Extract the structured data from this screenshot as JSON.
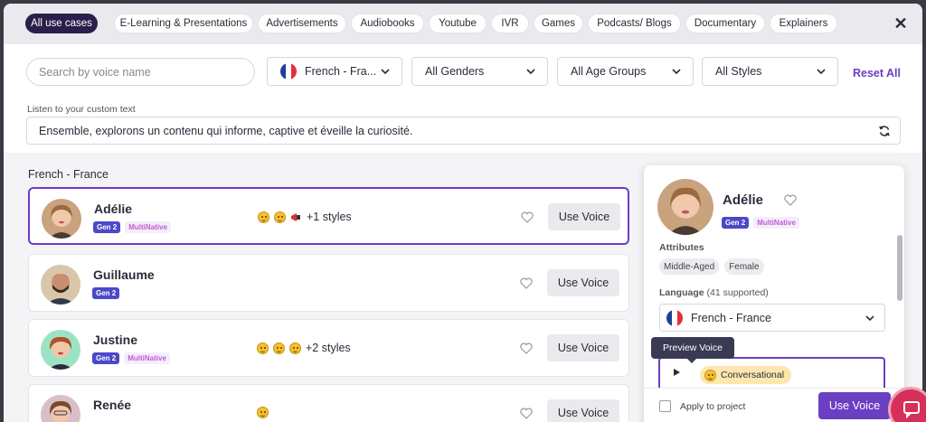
{
  "tabs": [
    {
      "label": "All use cases",
      "active": true
    },
    {
      "label": "E-Learning & Presentations",
      "active": false
    },
    {
      "label": "Advertisements",
      "active": false
    },
    {
      "label": "Audiobooks",
      "active": false
    },
    {
      "label": "Youtube",
      "active": false
    },
    {
      "label": "IVR",
      "active": false
    },
    {
      "label": "Games",
      "active": false
    },
    {
      "label": "Podcasts/ Blogs",
      "active": false
    },
    {
      "label": "Documentary",
      "active": false
    },
    {
      "label": "Explainers",
      "active": false
    }
  ],
  "close_label": "✕",
  "filters": {
    "search_placeholder": "Search by voice name",
    "language": "French - Fra...",
    "gender": "All Genders",
    "age": "All Age Groups",
    "style": "All Styles",
    "reset": "Reset All"
  },
  "custom_text": {
    "label": "Listen to your custom text",
    "value": "Ensemble, explorons un contenu qui informe, captive et éveille la curiosité."
  },
  "language_heading": "French - France",
  "voices": [
    {
      "name": "Adélie",
      "gen": "Gen 2",
      "multi": "MultiNative",
      "styles_more": "+1 styles",
      "use_label": "Use Voice"
    },
    {
      "name": "Guillaume",
      "gen": "Gen 2",
      "multi": "",
      "styles_more": "",
      "use_label": "Use Voice"
    },
    {
      "name": "Justine",
      "gen": "Gen 2",
      "multi": "MultiNative",
      "styles_more": "+2 styles",
      "use_label": "Use Voice"
    },
    {
      "name": "Renée",
      "gen": "",
      "multi": "",
      "styles_more": "",
      "use_label": "Use Voice"
    }
  ],
  "panel": {
    "name": "Adélie",
    "gen": "Gen 2",
    "multi": "MultiNative",
    "attributes_label": "Attributes",
    "attributes": [
      "Middle-Aged",
      "Female"
    ],
    "language_label": "Language",
    "language_count": "(41 supported)",
    "language_value": "French - France",
    "tooltip": "Preview Voice",
    "style_label": "Conversational",
    "apply_label": "Apply to project",
    "use_label": "Use Voice"
  },
  "colors": {
    "accent": "#6a3fc2",
    "gen2_badge": "#4a49c8",
    "active_tab": "#2a1f4a",
    "chat_button": "#d6305a"
  }
}
